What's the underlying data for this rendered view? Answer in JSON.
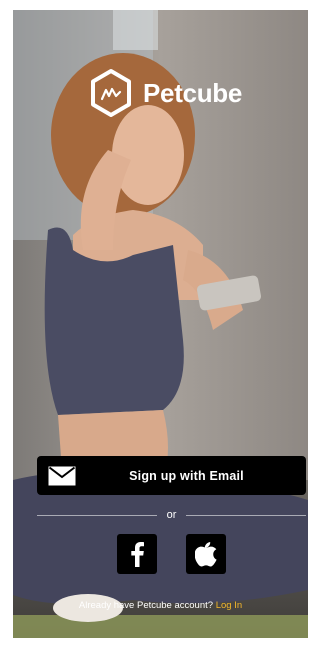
{
  "app": {
    "logo_text": "Petcube",
    "logo_icon": "petcube-hexagon-icon"
  },
  "signup": {
    "email_label": "Sign up with Email",
    "email_icon": "envelope-icon"
  },
  "divider": {
    "or_text": "or"
  },
  "social": {
    "facebook_icon": "facebook-icon",
    "apple_icon": "apple-icon"
  },
  "login": {
    "prompt": "Already have Petcube account?",
    "link_label": "Log In",
    "link_color": "#f2b62c"
  },
  "colors": {
    "button_bg": "#000000",
    "text": "#ffffff"
  }
}
